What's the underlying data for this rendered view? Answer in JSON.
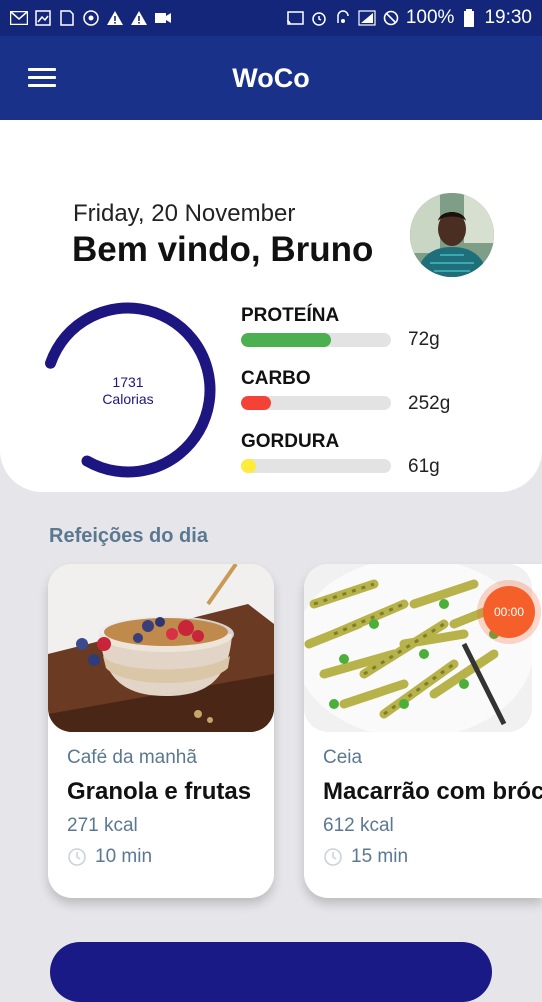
{
  "status_bar": {
    "battery": "100%",
    "time": "19:30"
  },
  "app": {
    "title": "WoCo"
  },
  "header": {
    "date": "Friday, 20 November",
    "welcome": "Bem vindo, Bruno"
  },
  "calories": {
    "value": "1731",
    "label": "Calorias",
    "progress": 0.78
  },
  "macros": [
    {
      "label": "PROTEÍNA",
      "value": "72g",
      "fraction": 0.6,
      "color": "#4caf50"
    },
    {
      "label": "CARBO",
      "value": "252g",
      "fraction": 0.2,
      "color": "#f44336"
    },
    {
      "label": "GORDURA",
      "value": "61g",
      "fraction": 0.1,
      "color": "#ffeb3b"
    }
  ],
  "meals_section": {
    "title": "Refeições do dia"
  },
  "meals": [
    {
      "type": "Café da manhã",
      "name": "Granola e frutas",
      "kcal": "271 kcal",
      "time": "10 min"
    },
    {
      "type": "Ceia",
      "name": "Macarrão com brócolis",
      "kcal": "612 kcal",
      "time": "15 min"
    }
  ],
  "timer": {
    "label": "00:00"
  },
  "colors": {
    "primary": "#1a318a",
    "ring": "#1d1580",
    "accent_orange": "#f5602a",
    "muted_text": "#5b7891"
  }
}
